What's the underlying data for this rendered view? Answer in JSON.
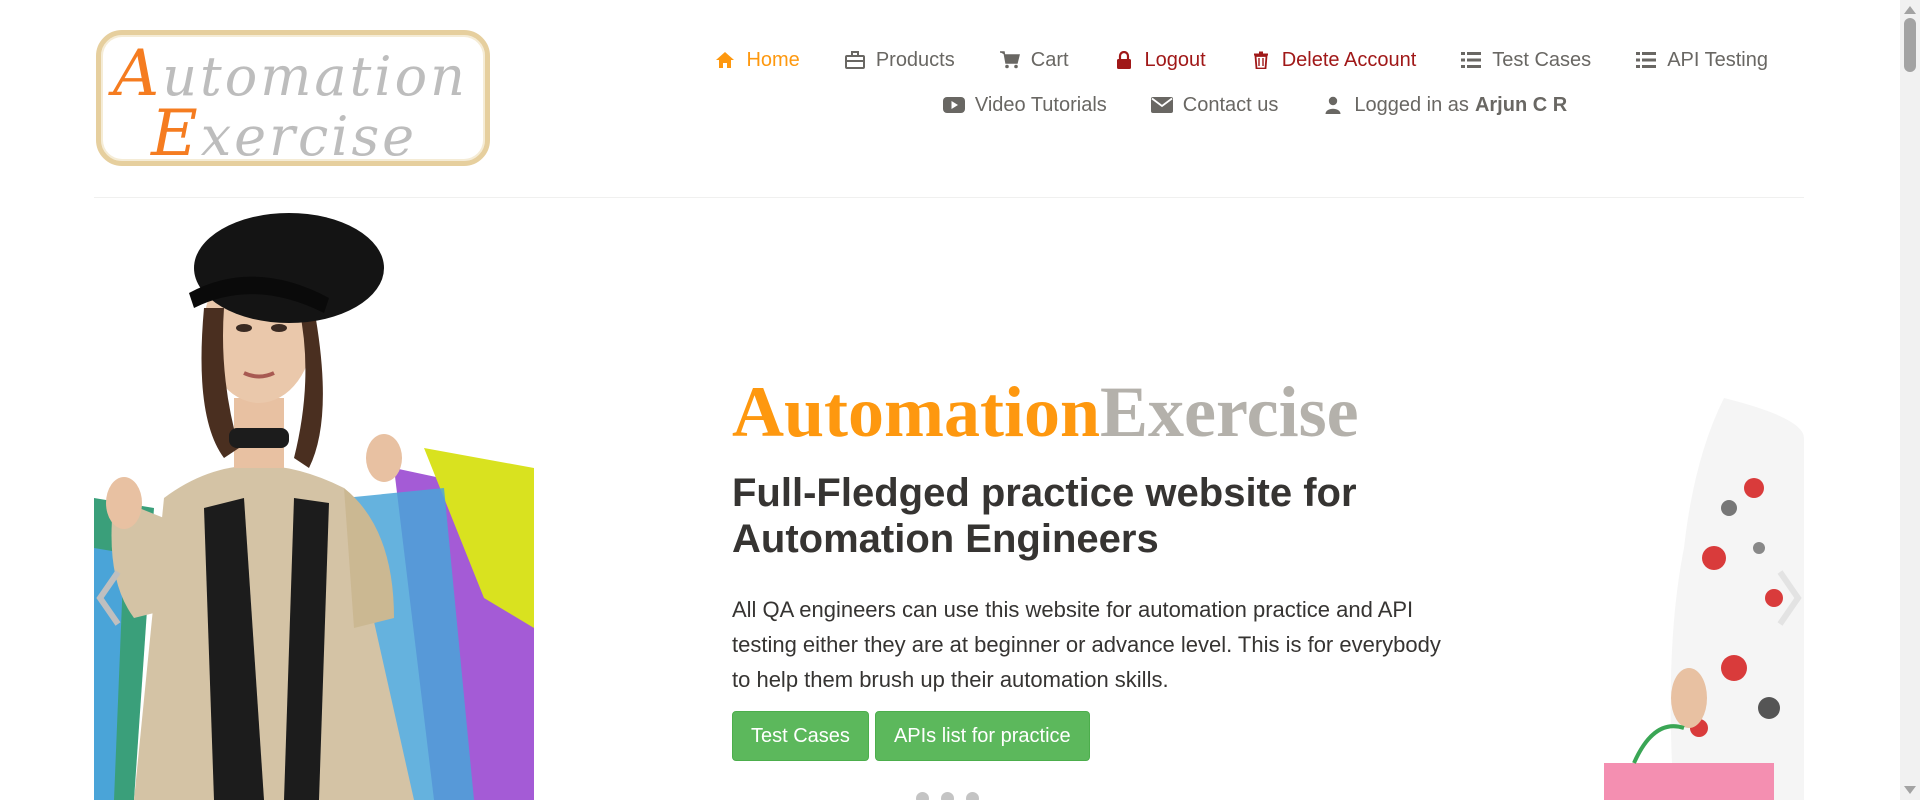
{
  "logo": {
    "line1_cap": "A",
    "line1_rest": "utomation",
    "line2_cap": "E",
    "line2_rest": "xercise"
  },
  "nav": {
    "row1": [
      {
        "label": "Home",
        "icon": "home-icon",
        "state": "active"
      },
      {
        "label": "Products",
        "icon": "briefcase-icon"
      },
      {
        "label": "Cart",
        "icon": "cart-icon"
      },
      {
        "label": "Logout",
        "icon": "lock-icon",
        "state": "danger"
      },
      {
        "label": "Delete Account",
        "icon": "trash-icon",
        "state": "danger"
      },
      {
        "label": "Test Cases",
        "icon": "list-icon"
      },
      {
        "label": "API Testing",
        "icon": "list-icon"
      }
    ],
    "row2": [
      {
        "label": "Video Tutorials",
        "icon": "youtube-play-icon"
      },
      {
        "label": "Contact us",
        "icon": "envelope-icon"
      },
      {
        "label": "Logged in as",
        "icon": "user-icon",
        "username": "Arjun C R"
      }
    ]
  },
  "hero": {
    "brand_part1": "Automation",
    "brand_part2": "Exercise",
    "headline": "Full-Fledged practice website for Automation Engineers",
    "description": "All QA engineers can use this website for automation practice and API testing either they are at beginner or advance level. This is for everybody to help them brush up their automation skills.",
    "buttons": [
      "Test Cases",
      "APIs list for practice"
    ],
    "slide_count": 3
  },
  "colors": {
    "accent": "#fe980f",
    "brand_gray": "#b4b1ab",
    "danger": "#a01818",
    "button_green": "#5cb85c",
    "text_dark": "#363432",
    "text_nav": "#696763"
  }
}
